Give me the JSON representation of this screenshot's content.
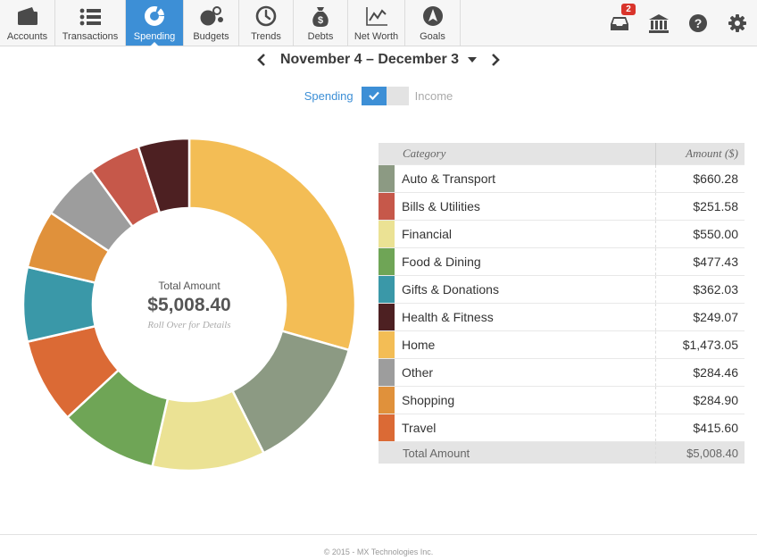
{
  "nav": {
    "tabs": [
      {
        "label": "Accounts",
        "icon": "wallet-icon"
      },
      {
        "label": "Transactions",
        "icon": "list-icon"
      },
      {
        "label": "Spending",
        "icon": "donut-chart-icon"
      },
      {
        "label": "Budgets",
        "icon": "bubbles-icon"
      },
      {
        "label": "Trends",
        "icon": "clock-icon"
      },
      {
        "label": "Debts",
        "icon": "money-bag-icon"
      },
      {
        "label": "Net Worth",
        "icon": "line-chart-icon"
      },
      {
        "label": "Goals",
        "icon": "compass-icon"
      }
    ],
    "active_tab": "Spending",
    "notifications_count": "2",
    "right_icons": [
      "inbox-icon",
      "bank-icon",
      "help-icon",
      "gear-icon"
    ]
  },
  "date_range": {
    "label": "November 4 – December 3"
  },
  "toggle": {
    "spending_label": "Spending",
    "income_label": "Income",
    "selected": "Spending"
  },
  "donut": {
    "center_label": "Total Amount",
    "center_amount": "$5,008.40",
    "center_hint": "Roll Over for Details"
  },
  "table": {
    "header_category": "Category",
    "header_amount": "Amount ($)",
    "rows": [
      {
        "category": "Auto & Transport",
        "amount": "$660.28"
      },
      {
        "category": "Bills & Utilities",
        "amount": "$251.58"
      },
      {
        "category": "Financial",
        "amount": "$550.00"
      },
      {
        "category": "Food & Dining",
        "amount": "$477.43"
      },
      {
        "category": "Gifts & Donations",
        "amount": "$362.03"
      },
      {
        "category": "Health & Fitness",
        "amount": "$249.07"
      },
      {
        "category": "Home",
        "amount": "$1,473.05"
      },
      {
        "category": "Other",
        "amount": "$284.46"
      },
      {
        "category": "Shopping",
        "amount": "$284.90"
      },
      {
        "category": "Travel",
        "amount": "$415.60"
      }
    ],
    "total_label": "Total Amount",
    "total_amount": "$5,008.40"
  },
  "chart_data": {
    "type": "pie",
    "categories": [
      "Home",
      "Auto & Transport",
      "Financial",
      "Food & Dining",
      "Travel",
      "Gifts & Donations",
      "Shopping",
      "Other",
      "Bills & Utilities",
      "Health & Fitness"
    ],
    "values": [
      1473.05,
      660.28,
      550.0,
      477.43,
      415.6,
      362.03,
      284.9,
      284.46,
      251.58,
      249.07
    ],
    "colors": [
      "#f3bd55",
      "#8c9a83",
      "#ebe294",
      "#6fa556",
      "#db6a35",
      "#3a98a8",
      "#e0913b",
      "#9d9d9d",
      "#c6584a",
      "#4d2022"
    ]
  },
  "colors": {
    "accent": "#3d8fd6",
    "Auto & Transport": "#8c9a83",
    "Bills & Utilities": "#c6584a",
    "Financial": "#ebe294",
    "Food & Dining": "#6fa556",
    "Gifts & Donations": "#3a98a8",
    "Health & Fitness": "#4d2022",
    "Home": "#f3bd55",
    "Other": "#9d9d9d",
    "Shopping": "#e0913b",
    "Travel": "#db6a35"
  },
  "footer": {
    "copyright": "© 2015 - MX Technologies Inc."
  }
}
